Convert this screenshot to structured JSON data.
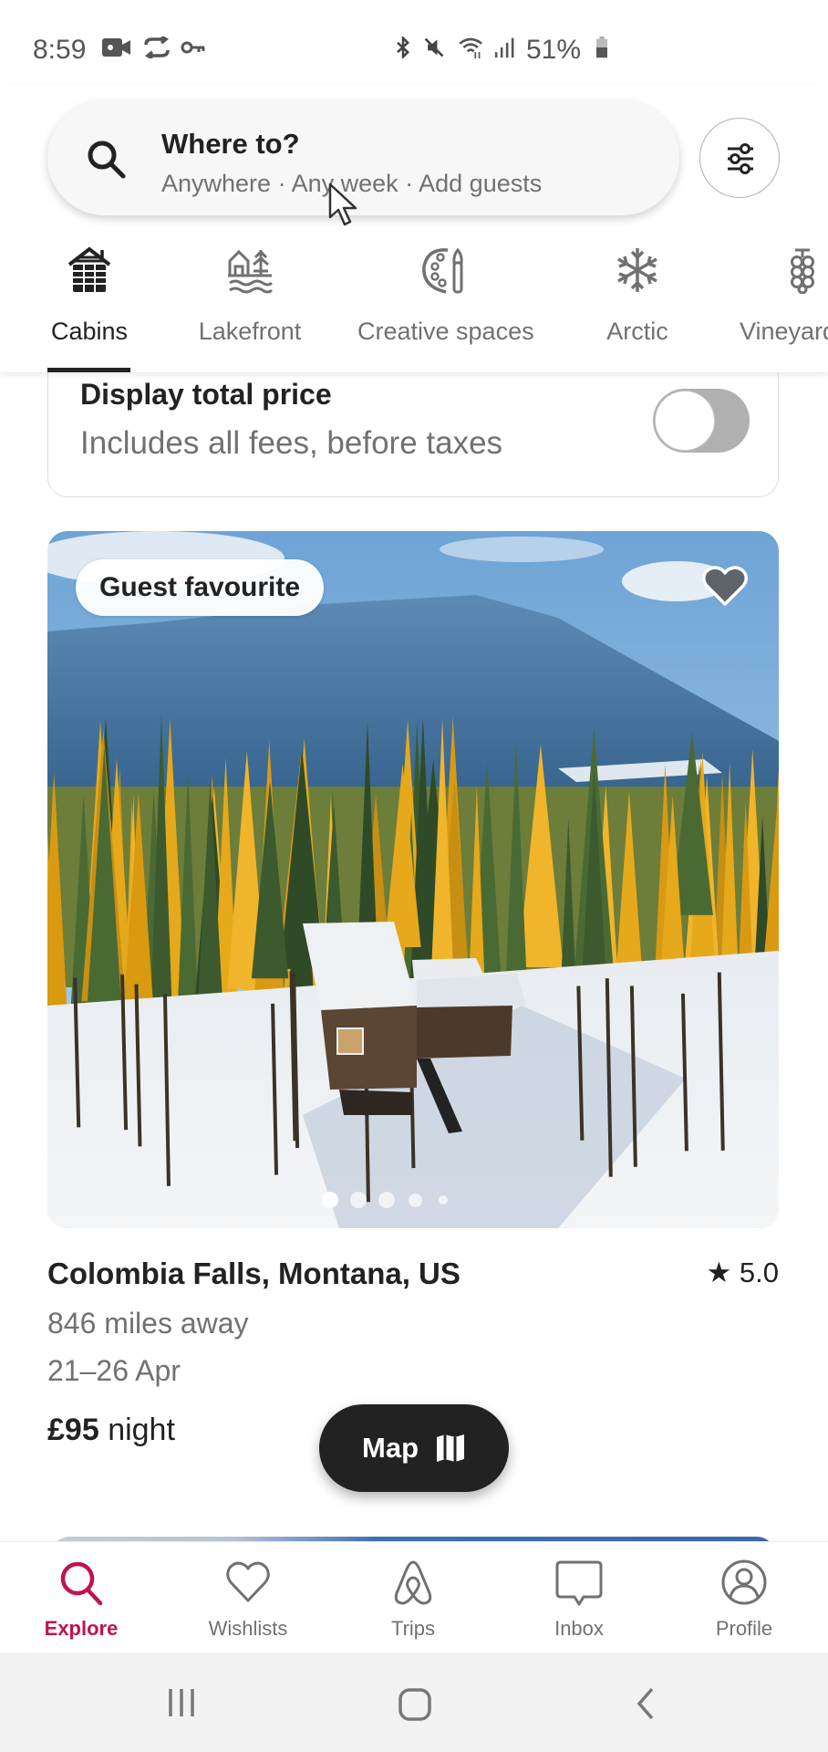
{
  "status_bar": {
    "time": "8:59",
    "left_icons": [
      "video-camera-icon",
      "sync-icon",
      "vpn-key-icon"
    ],
    "right_icons": [
      "bluetooth-icon",
      "mute-icon",
      "wifi-icon",
      "signal-icon"
    ],
    "battery": "51%"
  },
  "search": {
    "title": "Where to?",
    "subtitle": "Anywhere · Any week · Add guests"
  },
  "categories": [
    {
      "label": "Cabins",
      "icon": "cabin-icon",
      "active": true
    },
    {
      "label": "Lakefront",
      "icon": "lakefront-icon",
      "active": false
    },
    {
      "label": "Creative spaces",
      "icon": "palette-icon",
      "active": false
    },
    {
      "label": "Arctic",
      "icon": "snowflake-icon",
      "active": false
    },
    {
      "label": "Vineyards",
      "icon": "grapes-icon",
      "active": false
    }
  ],
  "price_toggle": {
    "title": "Display total price",
    "subtitle": "Includes all fees, before taxes",
    "enabled": false
  },
  "listing": {
    "badge": "Guest favourite",
    "location": "Colombia Falls, Montana, US",
    "rating": "5.0",
    "distance": "846 miles away",
    "dates": "21–26 Apr",
    "price": "£95",
    "price_unit": "night",
    "photo_count_dots": 5,
    "active_photo_index": 0
  },
  "map_button": {
    "label": "Map"
  },
  "bottom_nav": [
    {
      "label": "Explore",
      "icon": "search-icon",
      "active": true
    },
    {
      "label": "Wishlists",
      "icon": "heart-icon",
      "active": false
    },
    {
      "label": "Trips",
      "icon": "airbnb-logo-icon",
      "active": false
    },
    {
      "label": "Inbox",
      "icon": "message-icon",
      "active": false
    },
    {
      "label": "Profile",
      "icon": "profile-icon",
      "active": false
    }
  ],
  "colors": {
    "accent": "#c0134f",
    "text_primary": "#222222",
    "text_secondary": "#717171"
  }
}
